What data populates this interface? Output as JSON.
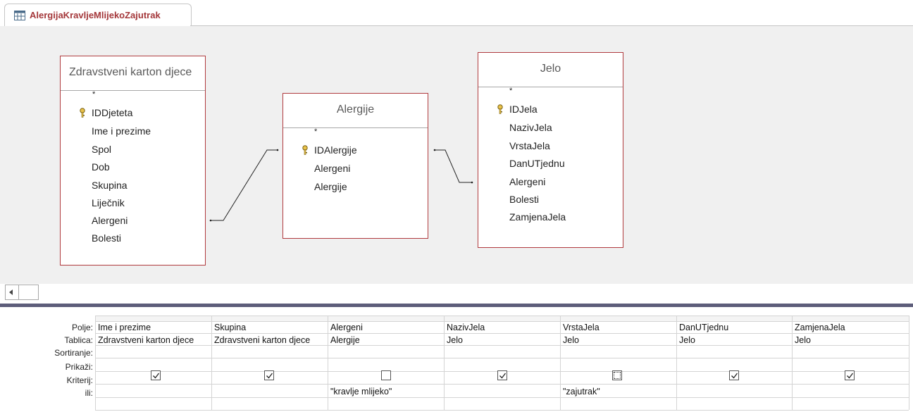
{
  "tab": {
    "title": "AlergijaKravljeMlijekoZajutrak",
    "icon": "query-design-icon"
  },
  "tables": [
    {
      "title": "Zdravstveni karton djece",
      "fields": [
        "*",
        "IDDjeteta",
        "Ime i prezime",
        "Spol",
        "Dob",
        "Skupina",
        "Liječnik",
        "Alergeni",
        "Bolesti"
      ],
      "key_field": "IDDjeteta"
    },
    {
      "title": "Alergije",
      "fields": [
        "*",
        "IDAlergije",
        "Alergeni",
        "Alergije"
      ],
      "key_field": "IDAlergije"
    },
    {
      "title": "Jelo",
      "fields": [
        "*",
        "IDJela",
        "NazivJela",
        "VrstaJela",
        "DanUTjednu",
        "Alergeni",
        "Bolesti",
        "ZamjenaJela"
      ],
      "key_field": "IDJela"
    }
  ],
  "grid": {
    "row_labels": [
      "Polje:",
      "Tablica:",
      "Sortiranje:",
      "Prikaži:",
      "Kriterij:",
      "ili:"
    ],
    "columns": [
      {
        "field": "Ime i prezime",
        "table": "Zdravstveni karton djece",
        "sort": "",
        "show": true,
        "criteria": "",
        "or": ""
      },
      {
        "field": "Skupina",
        "table": "Zdravstveni karton djece",
        "sort": "",
        "show": true,
        "criteria": "",
        "or": ""
      },
      {
        "field": "Alergeni",
        "table": "Alergije",
        "sort": "",
        "show": false,
        "criteria": "\"kravlje mlijeko\"",
        "or": ""
      },
      {
        "field": "NazivJela",
        "table": "Jelo",
        "sort": "",
        "show": true,
        "criteria": "",
        "or": ""
      },
      {
        "field": "VrstaJela",
        "table": "Jelo",
        "sort": "",
        "show": false,
        "criteria": "\"zajutrak\"",
        "or": ""
      },
      {
        "field": "DanUTjednu",
        "table": "Jelo",
        "sort": "",
        "show": true,
        "criteria": "",
        "or": ""
      },
      {
        "field": "ZamjenaJela",
        "table": "Jelo",
        "sort": "",
        "show": true,
        "criteria": "",
        "or": ""
      }
    ]
  },
  "colors": {
    "accent": "#a4373a",
    "table_border": "#b03a3e",
    "designer_bg": "#f0f0f0",
    "splitter": "#5d5d7a"
  }
}
